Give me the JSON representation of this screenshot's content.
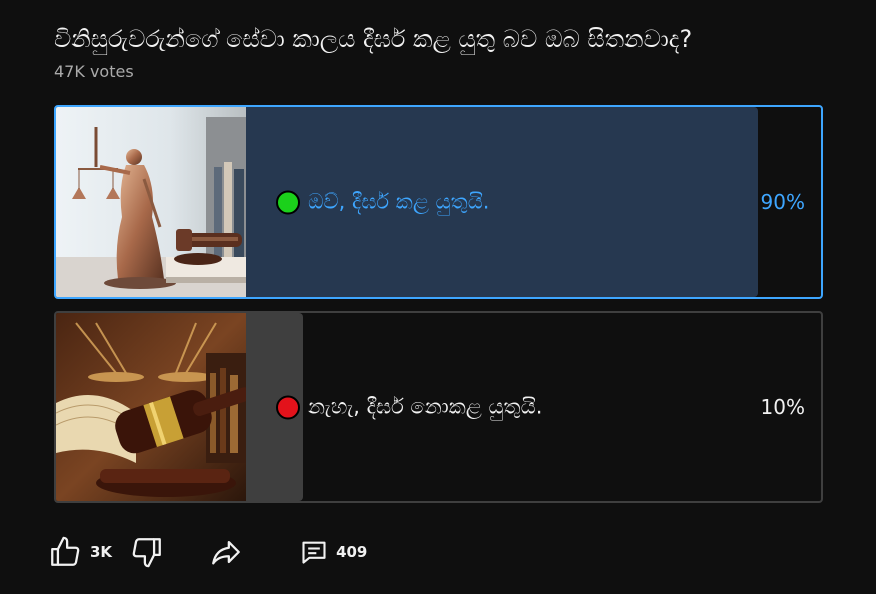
{
  "poll": {
    "question": "විනිසුරුවරුන්ගේ සේවා කාලය දීර්ඝ කළ යුතු බව ඔබ සිතනවාද?",
    "votes": "47K votes",
    "options": [
      {
        "label": "ඔව්, දීර්ඝ කළ යුතුයි.",
        "percent_text": "90%",
        "percent": 90,
        "selected": true,
        "dot_color": "#1bd11b",
        "image": "lady-justice-statue-with-gavel"
      },
      {
        "label": "නැහැ, දීර්ඝ නොකළ යුතුයි.",
        "percent_text": "10%",
        "percent": 10,
        "selected": false,
        "dot_color": "#e3121b",
        "image": "gavel-scales-and-books"
      }
    ]
  },
  "actions": {
    "like_icon": "thumbs-up-icon",
    "like_count": "3K",
    "dislike_icon": "thumbs-down-icon",
    "share_icon": "share-icon",
    "comment_icon": "comment-icon",
    "comment_count": "409"
  },
  "colors": {
    "background": "#0f0f0f",
    "accent": "#3ea6ff",
    "selected_bar": "#263850",
    "unselected_bar": "#3f3f3f"
  }
}
